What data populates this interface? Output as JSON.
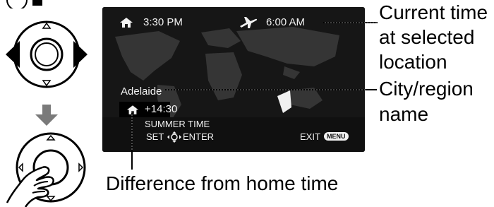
{
  "screen": {
    "home_time": "3:30 PM",
    "destination_time": "6:00 AM",
    "city": "Adelaide",
    "time_difference": "+14:30",
    "summer_time_label": "SUMMER TIME",
    "set_label": "SET",
    "enter_label": "ENTER",
    "exit_label": "EXIT",
    "menu_badge": "MENU"
  },
  "callouts": {
    "current_time": [
      "Current time",
      "at selected",
      "location"
    ],
    "city_region": [
      "City/region",
      "name"
    ],
    "difference": "Difference from home time"
  },
  "icons": {
    "home": "home-icon",
    "destination": "airplane-icon",
    "arrow": "arrow-down-icon",
    "hand": "hand-pointer-icon",
    "nav_pad": "four-way-dial-icon"
  }
}
